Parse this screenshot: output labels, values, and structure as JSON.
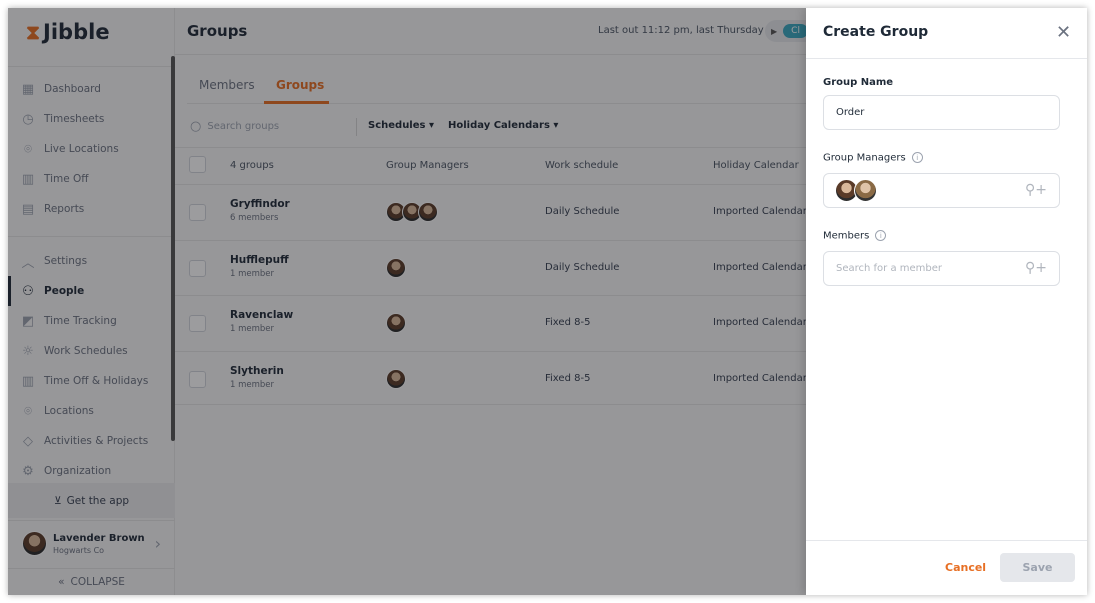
{
  "brand": {
    "name": "Jibble",
    "accent": "#e76f24"
  },
  "sidebar": {
    "items": [
      {
        "label": "Dashboard",
        "icon": "dashboard-icon"
      },
      {
        "label": "Timesheets",
        "icon": "clock-icon"
      },
      {
        "label": "Live Locations",
        "icon": "location-pin-icon"
      },
      {
        "label": "Time Off",
        "icon": "suitcase-icon"
      },
      {
        "label": "Reports",
        "icon": "clipboard-icon"
      }
    ],
    "settings_label": "Settings",
    "settings_items": [
      {
        "label": "People",
        "icon": "people-icon",
        "active": true
      },
      {
        "label": "Time Tracking",
        "icon": "time-tracking-icon"
      },
      {
        "label": "Work Schedules",
        "icon": "sun-icon"
      },
      {
        "label": "Time Off & Holidays",
        "icon": "suitcase-icon"
      },
      {
        "label": "Locations",
        "icon": "location-pin-icon"
      },
      {
        "label": "Activities & Projects",
        "icon": "tag-icon"
      },
      {
        "label": "Organization",
        "icon": "gear-icon"
      }
    ],
    "get_app": "Get the app",
    "user": {
      "name": "Lavender Brown",
      "company": "Hogwarts Co"
    },
    "collapse": "COLLAPSE"
  },
  "header": {
    "title": "Groups",
    "last_out": "Last out 11:12 pm, last Thursday",
    "clock_in": "Cl"
  },
  "tabs": [
    {
      "label": "Members"
    },
    {
      "label": "Groups",
      "active": true
    }
  ],
  "toolbar": {
    "search_placeholder": "Search groups",
    "filters": [
      "Schedules",
      "Holiday Calendars"
    ]
  },
  "table": {
    "count": "4 groups",
    "columns": [
      "Group Managers",
      "Work schedule",
      "Holiday Calendar"
    ],
    "rows": [
      {
        "name": "Gryffindor",
        "members": "6 members",
        "managers": 3,
        "schedule": "Daily Schedule",
        "holiday": "Imported Calendar ("
      },
      {
        "name": "Hufflepuff",
        "members": "1 member",
        "managers": 1,
        "schedule": "Daily Schedule",
        "holiday": "Imported Calendar ("
      },
      {
        "name": "Ravenclaw",
        "members": "1 member",
        "managers": 1,
        "schedule": "Fixed 8-5",
        "holiday": "Imported Calendar ("
      },
      {
        "name": "Slytherin",
        "members": "1 member",
        "managers": 1,
        "schedule": "Fixed 8-5",
        "holiday": "Imported Calendar ("
      }
    ]
  },
  "panel": {
    "title": "Create Group",
    "group_name_label": "Group Name",
    "group_name_value": "Order",
    "managers_label": "Group Managers",
    "members_label": "Members",
    "members_placeholder": "Search for a member",
    "cancel": "Cancel",
    "save": "Save"
  }
}
